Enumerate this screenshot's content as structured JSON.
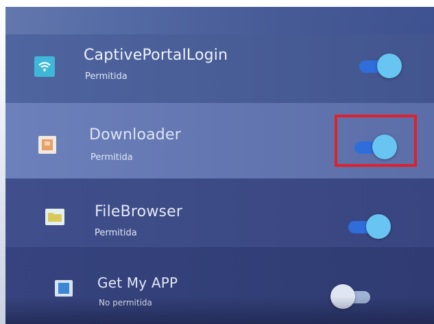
{
  "apps": [
    {
      "name": "CaptivePortalLogin",
      "status": "Permitida",
      "enabled": true,
      "icon": "wifi-icon",
      "icon_color": "#3fb7d6"
    },
    {
      "name": "Downloader",
      "status": "Permitida",
      "enabled": true,
      "icon": "downloader-app-icon",
      "icon_color": "#e6a06a"
    },
    {
      "name": "FileBrowser",
      "status": "Permitida",
      "enabled": true,
      "icon": "folder-icon",
      "icon_color": "#d9c85a"
    },
    {
      "name": "Get My APP",
      "status": "No permitida",
      "enabled": false,
      "icon": "get-my-app-icon",
      "icon_color": "#3c86d6"
    }
  ],
  "highlight": {
    "target": "Downloader toggle",
    "color": "#e0202a"
  },
  "colors": {
    "toggle_on_track": "#2f6ddb",
    "toggle_on_thumb": "#68c5f2",
    "toggle_off_track": "#9fb4d4",
    "toggle_off_thumb": "#dfe6f2"
  }
}
